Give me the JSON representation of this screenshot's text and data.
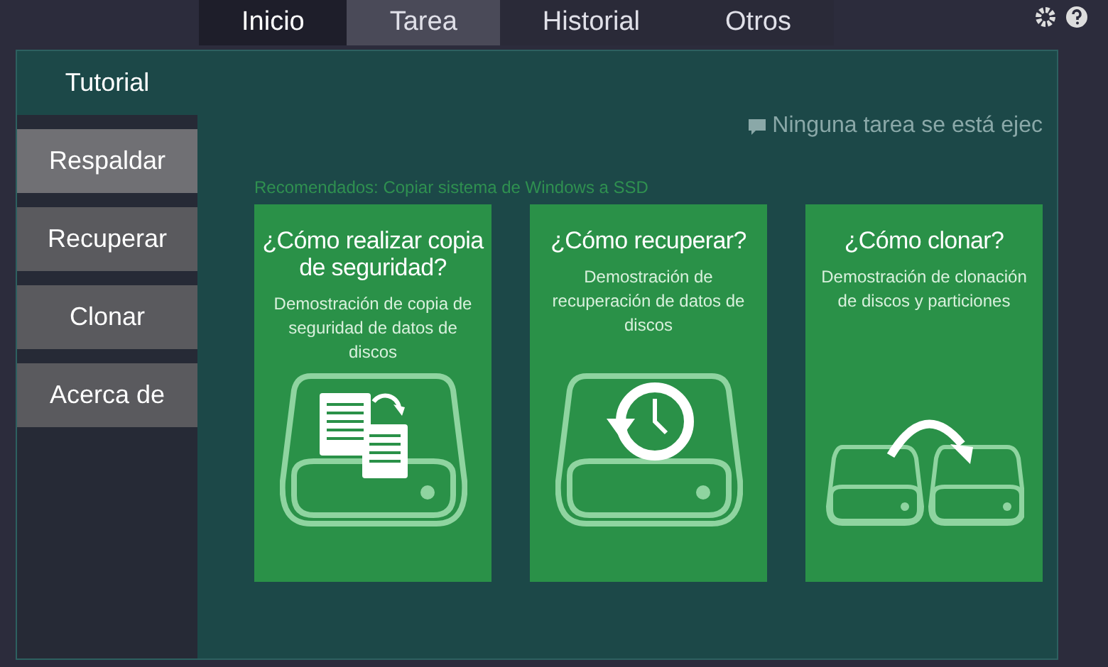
{
  "tabs": [
    {
      "label": "Inicio",
      "selected": true
    },
    {
      "label": "Tarea",
      "selected": false
    },
    {
      "label": "Historial",
      "selected": false
    },
    {
      "label": "Otros",
      "selected": false
    }
  ],
  "sidebar": {
    "items": [
      {
        "label": "Tutorial",
        "selected": true,
        "hovered": false
      },
      {
        "label": "Respaldar",
        "selected": false,
        "hovered": true
      },
      {
        "label": "Recuperar",
        "selected": false,
        "hovered": false
      },
      {
        "label": "Clonar",
        "selected": false,
        "hovered": false
      },
      {
        "label": "Acerca de",
        "selected": false,
        "hovered": false
      }
    ]
  },
  "status": "Ninguna tarea se está ejec",
  "recommended": "Recomendados: Copiar sistema de Windows a SSD",
  "cards": [
    {
      "kind": "backup",
      "title": "¿Cómo realizar copia de seguridad?",
      "description": "Demostración de copia de seguridad de datos de discos"
    },
    {
      "kind": "restore",
      "title": "¿Cómo recuperar?",
      "description": "Demostración de recuperación de datos de discos"
    },
    {
      "kind": "clone",
      "title": "¿Cómo clonar?",
      "description": "Demostración de clonación de discos y particiones"
    }
  ]
}
